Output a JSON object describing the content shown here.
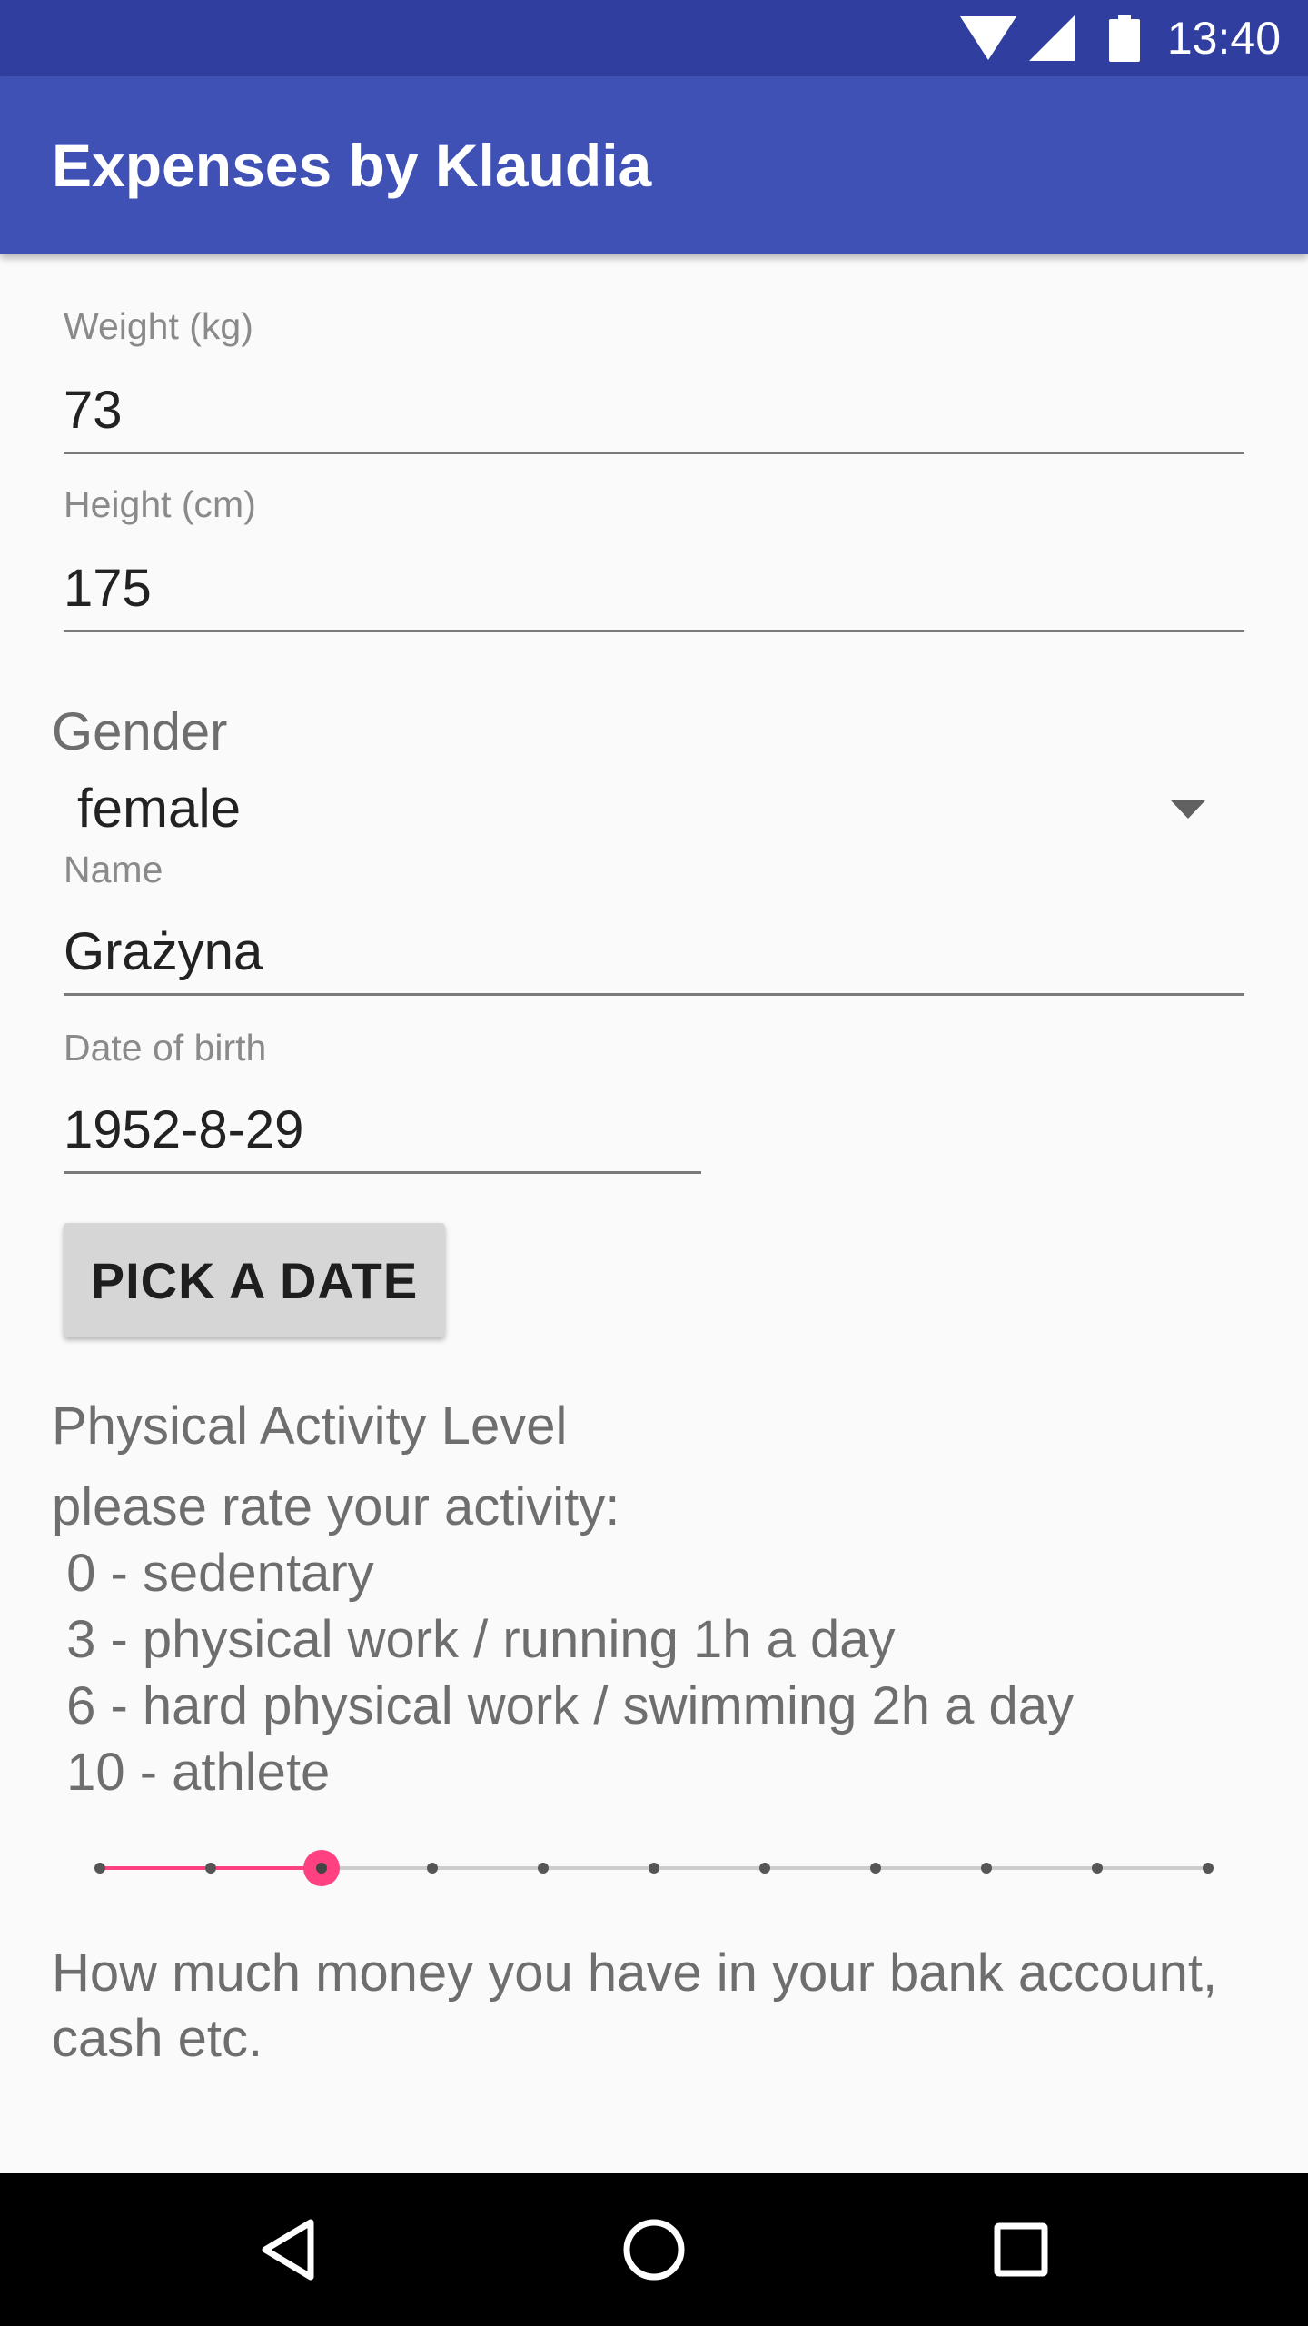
{
  "status_bar": {
    "time": "13:40",
    "icons": [
      "wifi-icon",
      "signal-icon",
      "battery-icon"
    ]
  },
  "app_bar": {
    "title": "Expenses by Klaudia"
  },
  "form": {
    "weight": {
      "label": "Weight (kg)",
      "value": "73"
    },
    "height": {
      "label": "Height (cm)",
      "value": "175"
    },
    "gender": {
      "title": "Gender",
      "selected": "female"
    },
    "name": {
      "label": "Name",
      "value": "Grażyna"
    },
    "dob": {
      "label": "Date of birth",
      "value": "1952-8-29"
    },
    "pick_date_button": "PICK A DATE",
    "activity": {
      "title": "Physical Activity Level",
      "help_lines": [
        "please rate your activity:",
        " 0 - sedentary",
        " 3 - physical work / running 1h a day",
        " 6 - hard physical work / swimming 2h a day",
        " 10 - athlete"
      ],
      "slider": {
        "min": 0,
        "max": 10,
        "value": 2
      }
    },
    "money_title": "How much money you have in your bank account, cash etc."
  },
  "colors": {
    "status_bar": "#303f9f",
    "app_bar": "#3f51b5",
    "accent": "#ff4081",
    "background": "#fafafa",
    "nav_bar": "#000000"
  },
  "nav_bar": {
    "icons": [
      "back-icon",
      "home-icon",
      "recents-icon"
    ]
  }
}
